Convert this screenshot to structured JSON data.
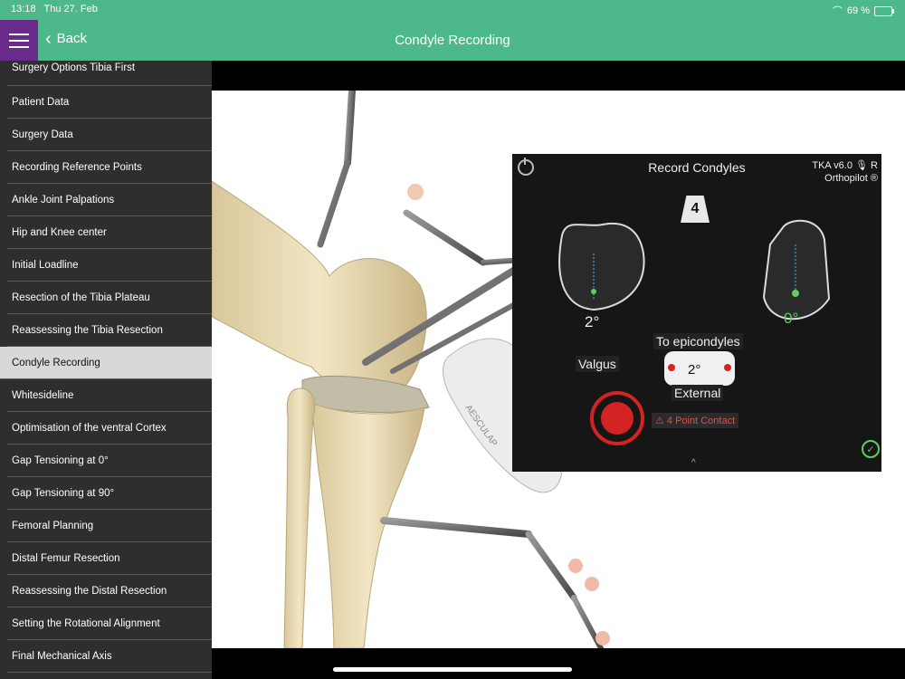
{
  "status": {
    "time": "13:18",
    "date": "Thu 27. Feb",
    "battery": "69 %",
    "battery_fill": 0.69
  },
  "nav": {
    "back_label": "Back",
    "title": "Condyle Recording"
  },
  "sidebar": {
    "items": [
      {
        "label": "Surgery Options Tibia First"
      },
      {
        "label": "Patient Data"
      },
      {
        "label": "Surgery Data"
      },
      {
        "label": "Recording Reference Points"
      },
      {
        "label": "Ankle Joint Palpations"
      },
      {
        "label": "Hip and Knee center"
      },
      {
        "label": "Initial Loadline"
      },
      {
        "label": "Resection of the Tibia Plateau"
      },
      {
        "label": "Reassessing the Tibia Resection"
      },
      {
        "label": "Condyle Recording",
        "active": true
      },
      {
        "label": "Whitesideline"
      },
      {
        "label": "Optimisation of the ventral Cortex"
      },
      {
        "label": "Gap Tensioning at 0°"
      },
      {
        "label": "Gap Tensioning at 90°"
      },
      {
        "label": "Femoral Planning"
      },
      {
        "label": "Distal Femur Resection"
      },
      {
        "label": "Reassessing the Distal Resection"
      },
      {
        "label": "Setting the Rotational Alignment"
      },
      {
        "label": "Final Mechanical Axis"
      }
    ]
  },
  "screen": {
    "title": "Record Condyles",
    "version_line1": "TKA v6.0 🎙 R",
    "version_line2": "Orthopilot ®",
    "count": "4",
    "left_angle": "2°",
    "right_angle": "0°",
    "valgus_label": "Valgus",
    "epicondyles_label": "To epicondyles",
    "epicondyles_angle": "2°",
    "external_label": "External",
    "warning": "⚠ 4 Point Contact",
    "brand": "AESCULAP"
  },
  "colors": {
    "header": "#4db88a",
    "menu": "#6a2a8c",
    "record": "#d42323",
    "ok": "#5bd05b"
  }
}
